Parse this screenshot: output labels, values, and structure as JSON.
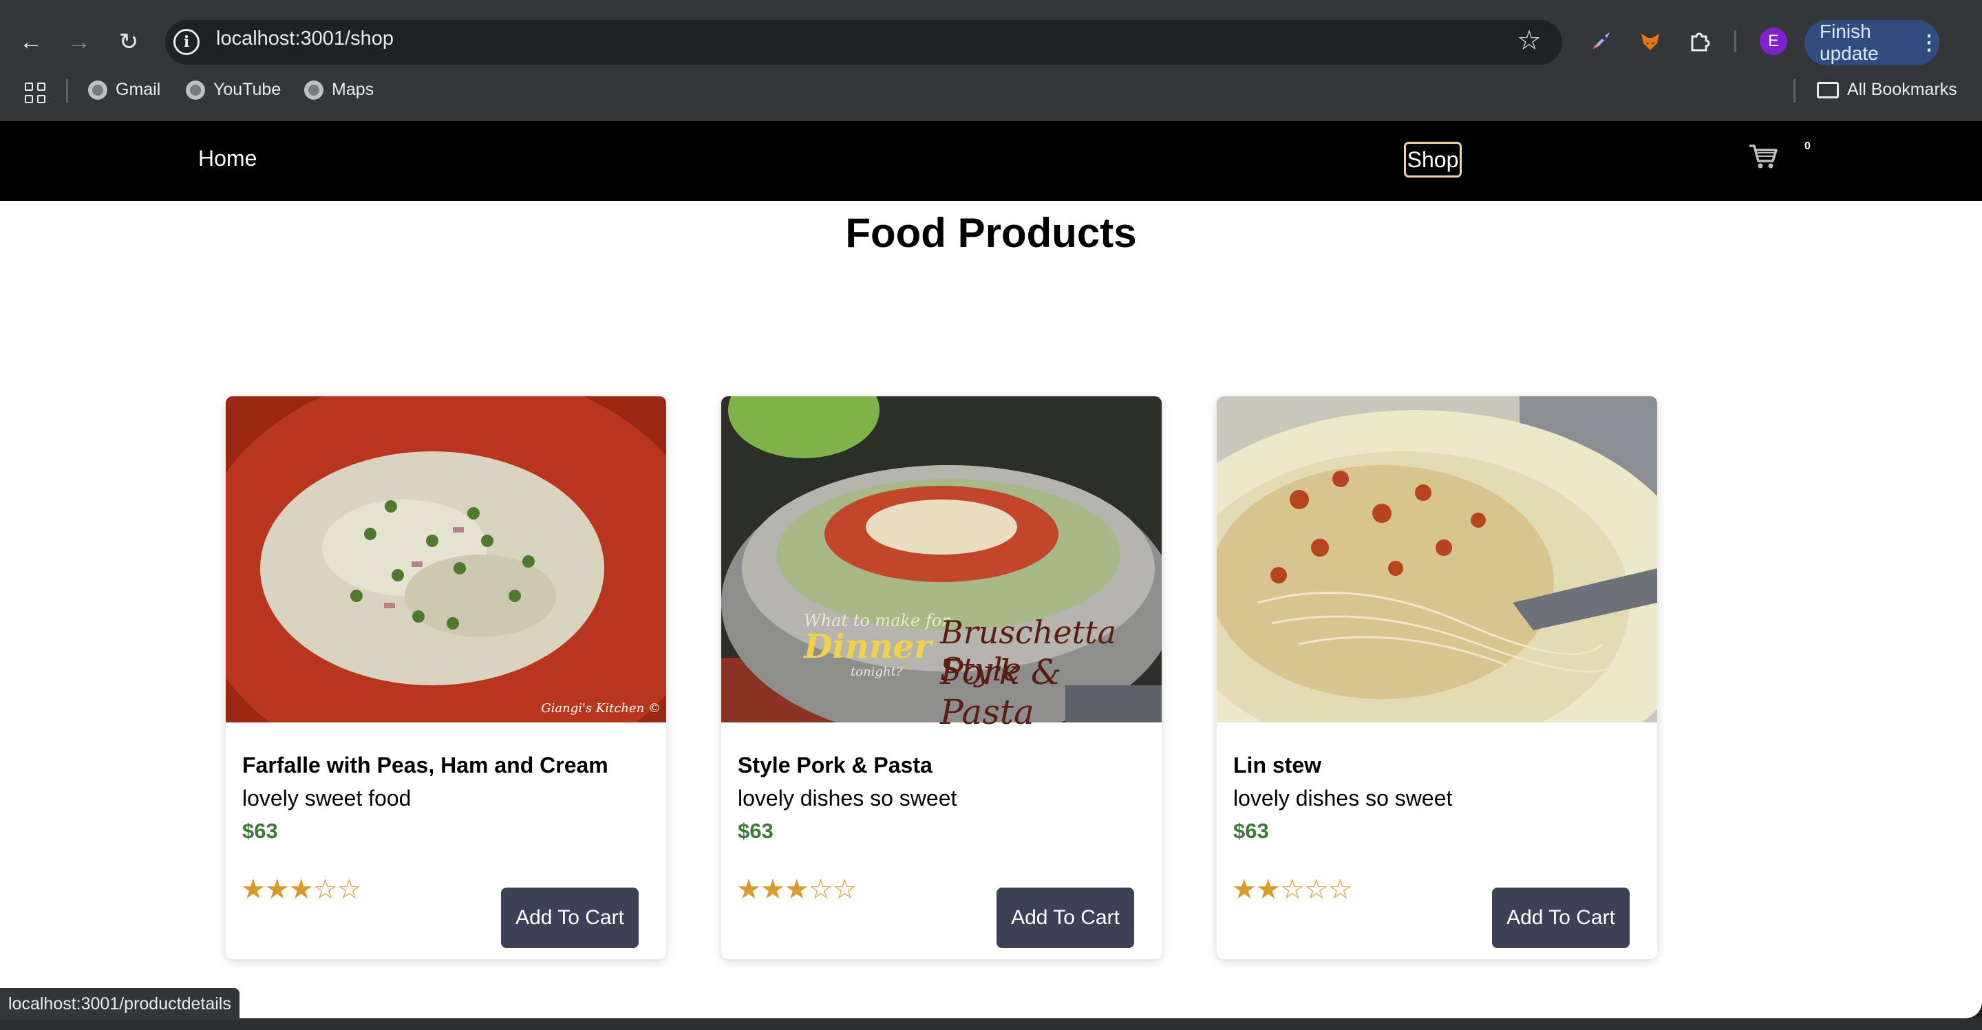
{
  "browser": {
    "url": "localhost:3001/shop",
    "bookmarks": [
      "Gmail",
      "YouTube",
      "Maps"
    ],
    "all_bookmarks": "All Bookmarks",
    "profile_initial": "E",
    "finish_update": "Finish update",
    "status_url": "localhost:3001/productdetails"
  },
  "nav": {
    "home": "Home",
    "shop": "Shop",
    "cart_count": "0"
  },
  "page": {
    "title": "Food Products"
  },
  "products": [
    {
      "name": "Farfalle with Peas, Ham and Cream",
      "description": "lovely sweet food",
      "price": "$63",
      "rating": 3,
      "max_rating": 5,
      "button": "Add To Cart",
      "image_watermark": "Giangi's Kitchen ©"
    },
    {
      "name": "Style Pork & Pasta",
      "description": "lovely dishes so sweet",
      "price": "$63",
      "rating": 3,
      "max_rating": 5,
      "button": "Add To Cart",
      "image_text": [
        "What to make for",
        "Dinner",
        "tonight?",
        "Bruschetta Style",
        "Pork & Pasta"
      ]
    },
    {
      "name": "Lin stew",
      "description": "lovely dishes so sweet",
      "price": "$63",
      "rating": 2,
      "max_rating": 5,
      "button": "Add To Cart"
    }
  ],
  "colors": {
    "price_green": "#3d7a3a",
    "button_bg": "#3b4256",
    "star_gold": "#d99a2b",
    "shop_outline": "#f3d2a3"
  }
}
